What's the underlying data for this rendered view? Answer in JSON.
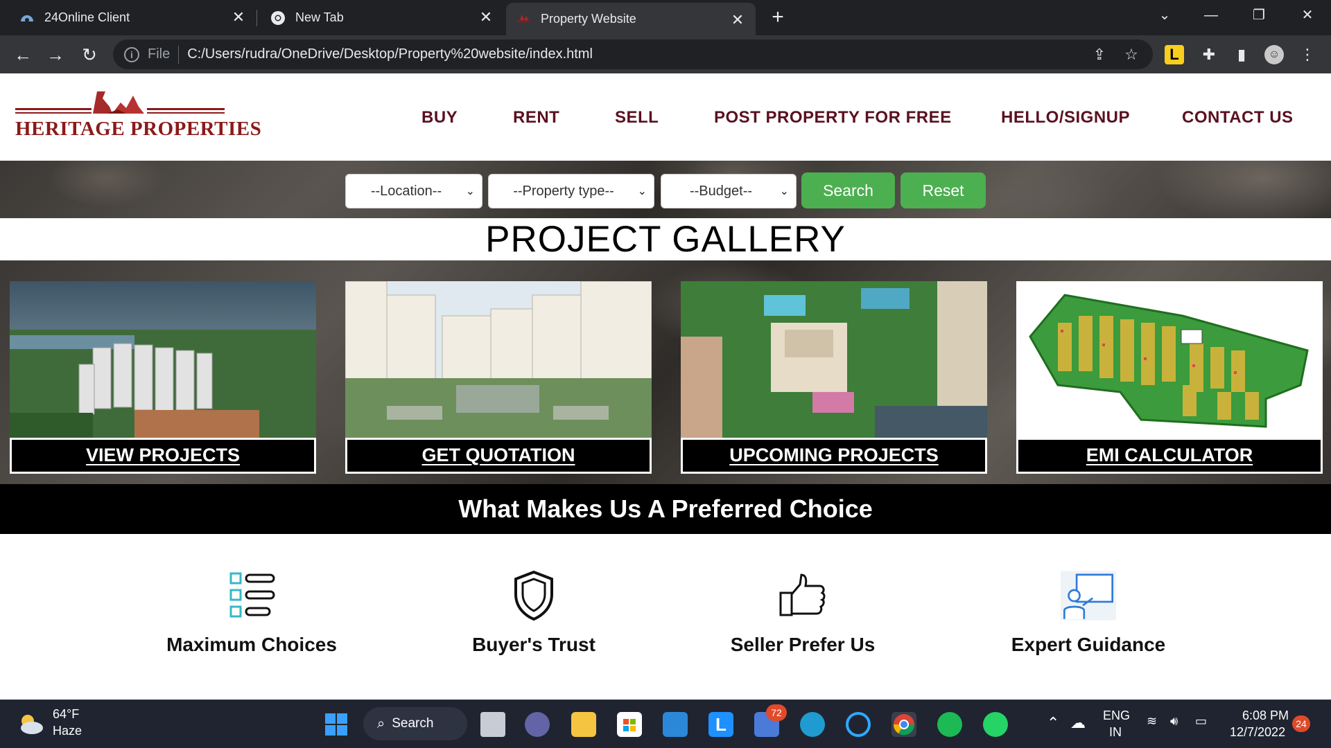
{
  "browser": {
    "tabs": [
      {
        "title": "24Online Client",
        "active": false
      },
      {
        "title": "New Tab",
        "active": false
      },
      {
        "title": "Property Website",
        "active": true
      }
    ],
    "new_tab_symbol": "+",
    "close_symbol": "✕",
    "address": {
      "scheme_label": "File",
      "url": "C:/Users/rudra/OneDrive/Desktop/Property%20website/index.html"
    }
  },
  "site": {
    "logo_text": "HERITAGE PROPERTIES",
    "brand_color": "#8b1a1a",
    "nav": [
      "BUY",
      "RENT",
      "SELL",
      "POST PROPERTY FOR FREE",
      "HELLO/SIGNUP",
      "CONTACT US"
    ],
    "search": {
      "location": "--Location--",
      "property_type": "--Property type--",
      "budget": "--Budget--",
      "search_label": "Search",
      "reset_label": "Reset",
      "button_color": "#4caf50"
    },
    "gallery_title": "PROJECT GALLERY",
    "cards": [
      {
        "caption": "VIEW PROJECTS",
        "image": "aerial-apartment-towers"
      },
      {
        "caption": "GET QUOTATION",
        "image": "apartment-courtyard-garden"
      },
      {
        "caption": "UPCOMING PROJECTS",
        "image": "villa-pool-aerial"
      },
      {
        "caption": "EMI CALCULATOR",
        "image": "plot-layout-map"
      }
    ],
    "preferred_heading": "What Makes Us A Preferred Choice",
    "features": [
      {
        "label": "Maximum Choices",
        "icon": "checklist-icon"
      },
      {
        "label": "Buyer's Trust",
        "icon": "shield-icon"
      },
      {
        "label": "Seller Prefer Us",
        "icon": "thumbs-up-icon"
      },
      {
        "label": "Expert Guidance",
        "icon": "presenter-icon"
      }
    ]
  },
  "taskbar": {
    "weather_temp": "64°F",
    "weather_desc": "Haze",
    "search_label": "Search",
    "teams_badge": "72",
    "lang_1": "ENG",
    "lang_2": "IN",
    "time": "6:08 PM",
    "date": "12/7/2022",
    "notification_count": "24"
  }
}
